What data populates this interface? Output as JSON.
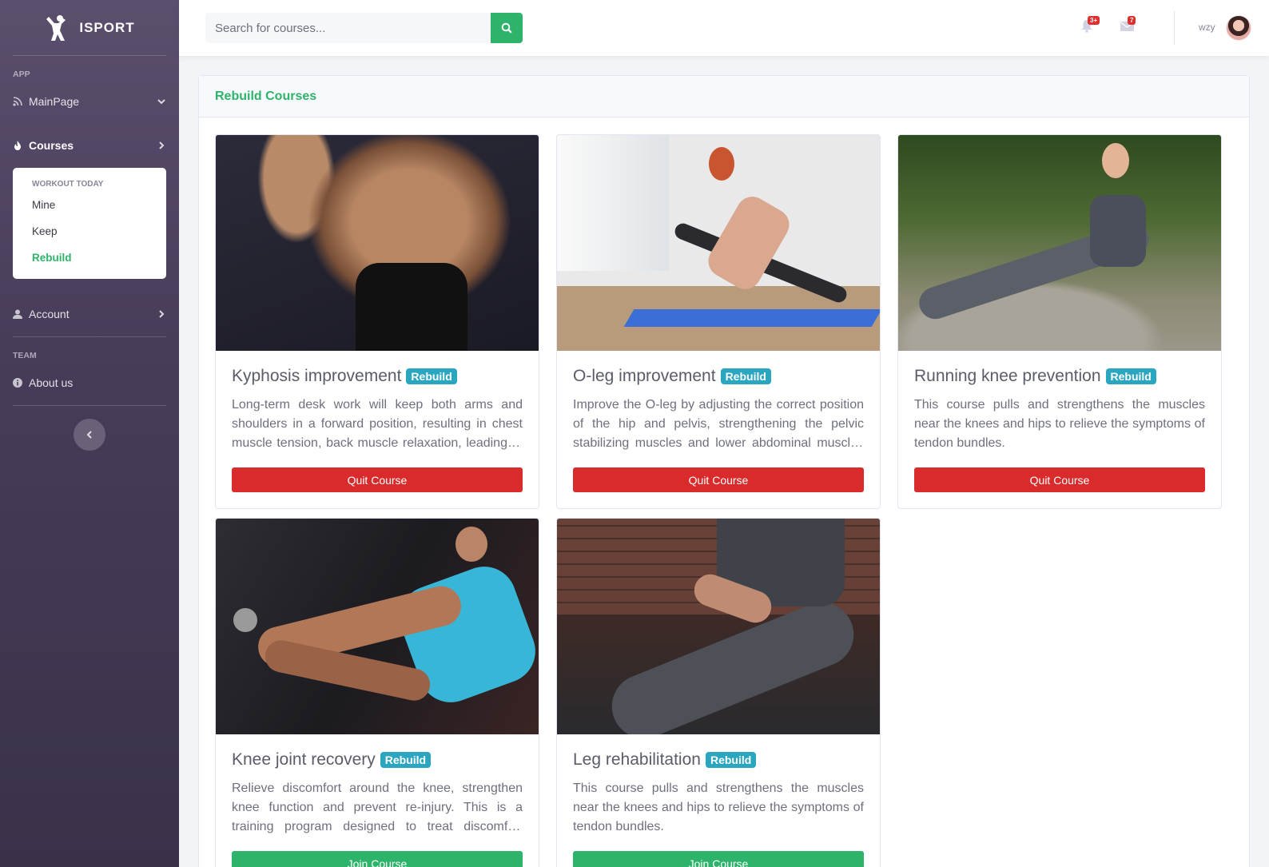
{
  "brand": {
    "name": "ISPORT"
  },
  "sidebar": {
    "section_app": "APP",
    "section_team": "TEAM",
    "items": {
      "mainpage": "MainPage",
      "courses": "Courses",
      "account": "Account",
      "about": "About us"
    },
    "courses_submenu": {
      "header": "WORKOUT TODAY",
      "items": [
        "Mine",
        "Keep",
        "Rebuild"
      ],
      "active": "Rebuild"
    }
  },
  "topbar": {
    "search_placeholder": "Search for courses...",
    "alerts_count": "3+",
    "messages_count": "7",
    "user_name": "wzy"
  },
  "main": {
    "title": "Rebuild Courses",
    "courses": [
      {
        "title": "Kyphosis improvement",
        "tag": "Rebuild",
        "description": "Long-term desk work will keep both arms and shoulders in a forward position, resulting in chest muscle tension, back muscle relaxation, leading to rounded shoulders and a hunched back over time.",
        "button": "Quit Course",
        "button_type": "quit"
      },
      {
        "title": "O-leg improvement",
        "tag": "Rebuild",
        "description": "Improve the O-leg by adjusting the correct position of the hip and pelvis, strengthening the pelvic stabilizing muscles and lower abdominal muscles to correct leg alignment.",
        "button": "Quit Course",
        "button_type": "quit"
      },
      {
        "title": "Running knee prevention",
        "tag": "Rebuild",
        "description": "This course pulls and strengthens the muscles near the knees and hips to relieve the symptoms of tendon bundles.",
        "button": "Quit Course",
        "button_type": "quit"
      },
      {
        "title": "Knee joint recovery",
        "tag": "Rebuild",
        "description": "Relieve discomfort around the knee, strengthen knee function and prevent re-injury. This is a training program designed to treat discomfort caused by knee injuries.",
        "button": "Join Course",
        "button_type": "join"
      },
      {
        "title": "Leg rehabilitation",
        "tag": "Rebuild",
        "description": "This course pulls and strengthens the muscles near the knees and hips to relieve the symptoms of tendon bundles.",
        "button": "Join Course",
        "button_type": "join"
      }
    ]
  },
  "colors": {
    "accent": "#2db36a",
    "danger": "#d92b2b",
    "tag": "#2aa6c0",
    "sidebar": "#473c5a"
  }
}
